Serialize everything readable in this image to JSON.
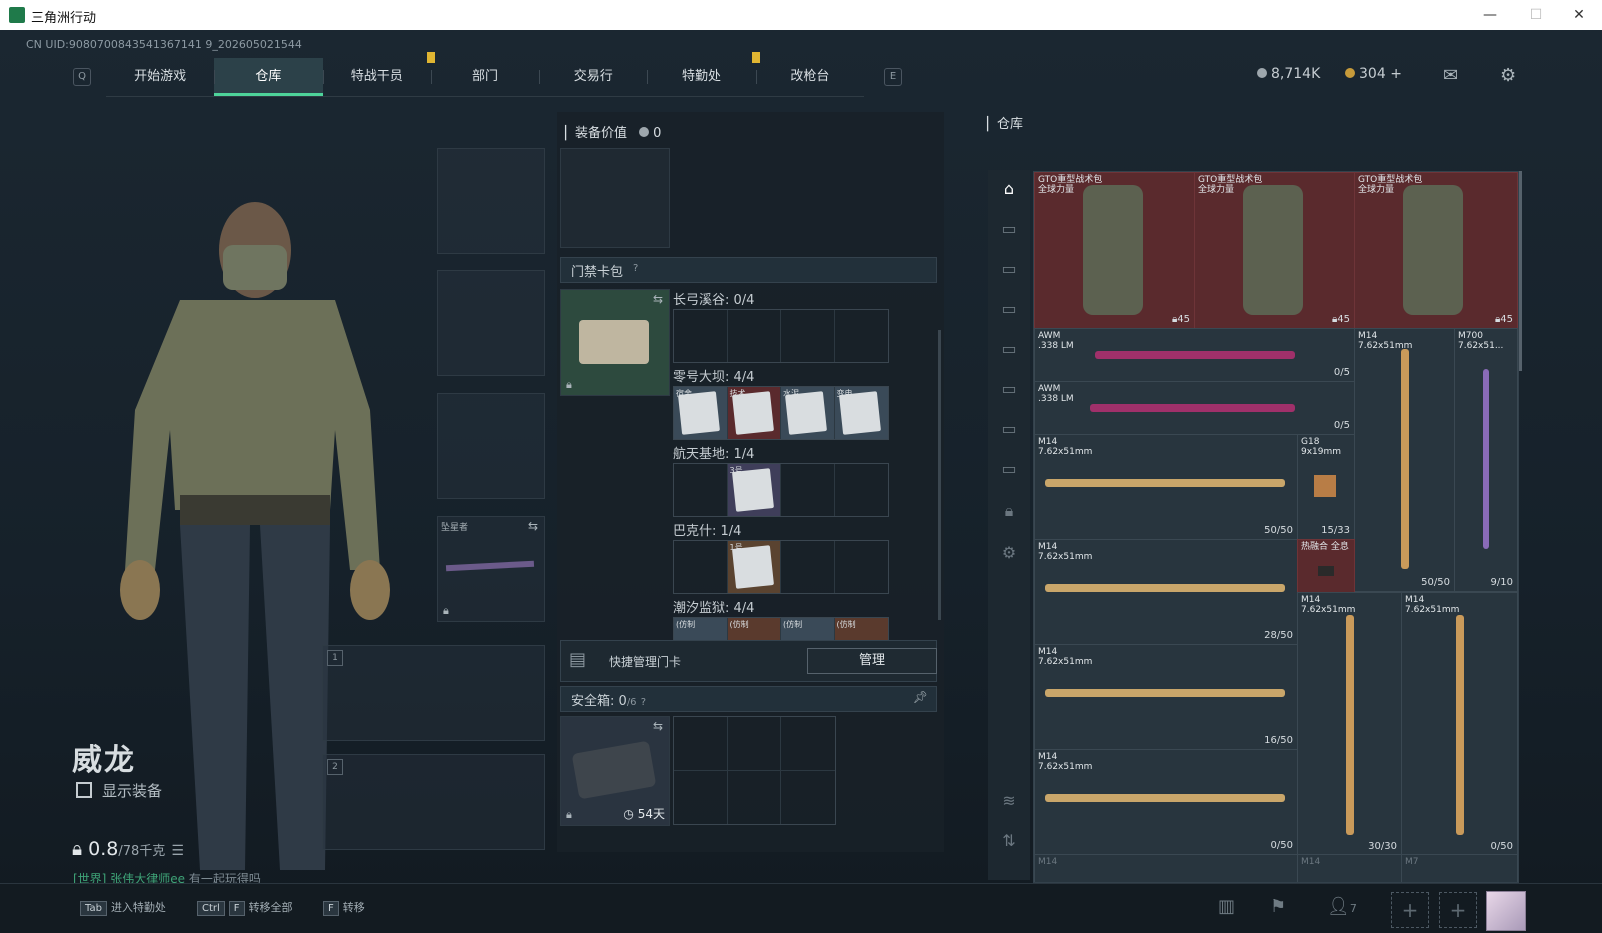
{
  "window": {
    "title": "三角洲行动",
    "minimize": "—",
    "maximize": "☐",
    "close": "✕"
  },
  "uid": "CN UID:9080700843541367141 9_202605021544",
  "nav": {
    "left_key": "Q",
    "right_key": "E",
    "tabs": [
      {
        "label": "开始游戏"
      },
      {
        "label": "仓库",
        "active": true
      },
      {
        "label": "特战干员",
        "notice": true
      },
      {
        "label": "部门"
      },
      {
        "label": "交易行"
      },
      {
        "label": "特勤处",
        "notice": true
      },
      {
        "label": "改枪台"
      }
    ]
  },
  "currency": {
    "silver": "8,714K",
    "gold": "304",
    "gold_plus": "+"
  },
  "character": {
    "name": "威龙",
    "show_equipment": "显示装备",
    "weight": "0.8",
    "weight_max": "/78千克"
  },
  "chat": {
    "channel": "[世界]",
    "user": "张伟大律师ee",
    "message": "有一起玩得吗"
  },
  "slots": {
    "melee_label": "坠星者",
    "weapon1_num": "1",
    "weapon2_num": "2"
  },
  "equip_value": {
    "label": "装备价值",
    "value": "0"
  },
  "keycard": {
    "header": "门禁卡包",
    "help": "?",
    "maps": [
      {
        "name": "长弓溪谷: 0/4",
        "cards": []
      },
      {
        "name": "零号大坝: 4/4",
        "cards": [
          "宿舍",
          "技术",
          "水泥",
          "变电"
        ]
      },
      {
        "name": "航天基地: 1/4",
        "cards": [
          "",
          "3号"
        ]
      },
      {
        "name": "巴克什: 1/4",
        "cards": [
          "",
          "1号"
        ]
      },
      {
        "name": "潮汐监狱: 4/4",
        "cards": [
          "(仿制",
          "(仿制",
          "(仿制",
          "(仿制"
        ]
      }
    ],
    "quick_label": "快捷管理门卡",
    "manage": "管理"
  },
  "safebox": {
    "label": "安全箱:",
    "value": "0",
    "max": "/6",
    "help": "?",
    "timer": "54天"
  },
  "warehouse": {
    "title": "仓库",
    "backpacks": [
      {
        "name": "GTO重型战术包",
        "sub": "全球力量",
        "qty": "45"
      },
      {
        "name": "GTO重型战术包",
        "sub": "全球力量",
        "qty": "45"
      },
      {
        "name": "GTO重型战术包",
        "sub": "全球力量",
        "qty": "45"
      }
    ],
    "items": {
      "awm1": {
        "name": "AWM",
        "cal": ".338 LM",
        "qty": "0/5"
      },
      "awm2": {
        "name": "AWM",
        "cal": ".338 LM",
        "qty": "0/5"
      },
      "m14a": {
        "name": "M14",
        "cal": "7.62x51mm",
        "qty": "50/50"
      },
      "g18": {
        "name": "G18",
        "cal": "9x19mm",
        "qty": "15/33"
      },
      "m14v": {
        "name": "M14",
        "cal": "7.62x51mm",
        "qty": "50/50"
      },
      "m700": {
        "name": "M700",
        "cal": "7.62x51...",
        "qty": "9/10"
      },
      "m14b": {
        "name": "M14",
        "cal": "7.62x51mm",
        "qty": "28/50"
      },
      "hotpot": {
        "name": "热融合 全息"
      },
      "m14c": {
        "name": "M14",
        "cal": "7.62x51mm",
        "qty": "16/50"
      },
      "m14d": {
        "name": "M14",
        "cal": "7.62x51mm",
        "qty": "0/50"
      },
      "m14v2": {
        "name": "M14",
        "cal": "7.62x51mm",
        "qty": "30/30"
      },
      "m14v3": {
        "name": "M14",
        "cal": "7.62x51mm",
        "qty": "0/50"
      },
      "bottom1": "M14",
      "bottom2": "M14",
      "bottom3": "M7"
    }
  },
  "bottombar": {
    "b1_key": "Tab",
    "b1_label": "进入特勤处",
    "b2_key": "Ctrl",
    "b2_key2": "F",
    "b2_label": "转移全部",
    "b3_key": "F",
    "b3_label": "转移",
    "friends": "7"
  },
  "colors": {
    "accent": "#4ed39a",
    "notice": "#e0b532",
    "highlight_item": "#5a2a2d"
  }
}
